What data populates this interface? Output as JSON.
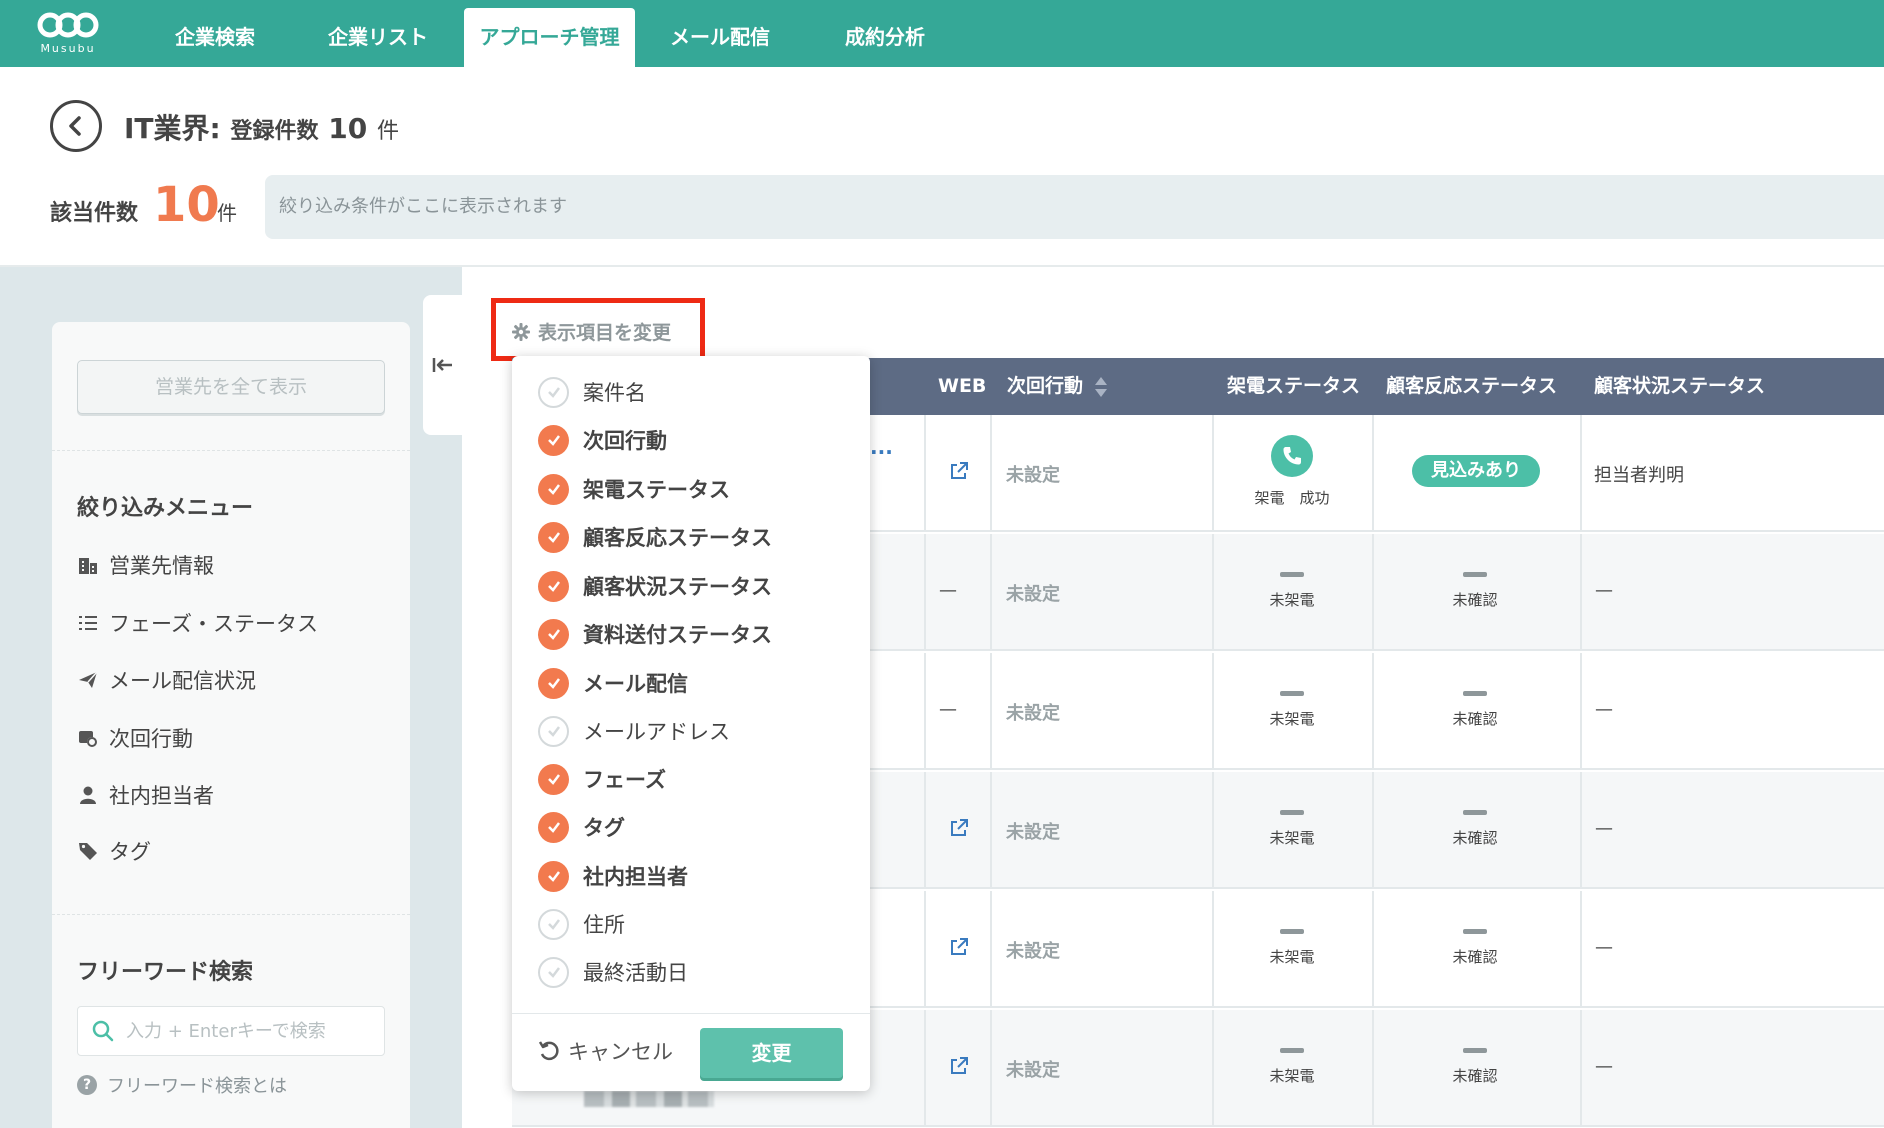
{
  "brand": {
    "logo_text": "Musubu",
    "color": "#35a897"
  },
  "nav": {
    "tabs": [
      {
        "label": "企業検索"
      },
      {
        "label": "企業リスト"
      },
      {
        "label": "アプローチ管理",
        "active": true
      },
      {
        "label": "メール配信"
      },
      {
        "label": "成約分析"
      }
    ]
  },
  "header": {
    "list_name": "IT業界:",
    "registered_label": "登録件数",
    "registered_count": "10",
    "registered_unit": "件",
    "matched_label": "該当件数",
    "matched_count": "10",
    "matched_unit": "件",
    "filter_placeholder": "絞り込み条件がここに表示されます"
  },
  "sidebar": {
    "show_all_label": "営業先を全て表示",
    "filter_menu_heading": "絞り込みメニュー",
    "menu_items": [
      {
        "label": "営業先情報",
        "icon": "building-icon"
      },
      {
        "label": "フェーズ・ステータス",
        "icon": "list-icon"
      },
      {
        "label": "メール配信状況",
        "icon": "paper-plane-icon"
      },
      {
        "label": "次回行動",
        "icon": "calendar-icon"
      },
      {
        "label": "社内担当者",
        "icon": "user-icon"
      },
      {
        "label": "タグ",
        "icon": "tag-icon"
      }
    ],
    "freeword_heading": "フリーワード検索",
    "search_placeholder": "入力 + Enterキーで検索",
    "help_label": "フリーワード検索とは"
  },
  "settings_button_label": "表示項目を変更",
  "table": {
    "headers": {
      "web": "WEB",
      "next_action": "次回行動",
      "call_status": "架電ステータス",
      "reaction_status": "顧客反応ステータス",
      "situation_status": "顧客状況ステータス"
    },
    "row1_truncated": "...",
    "rows": [
      {
        "web": "link",
        "next_action": "未設定",
        "call_status": "架電　成功",
        "reaction_status": "見込みあり",
        "situation_status": "担当者判明"
      },
      {
        "web": "—",
        "next_action": "未設定",
        "call_status": "未架電",
        "reaction_status": "未確認",
        "situation_status": "—"
      },
      {
        "web": "—",
        "next_action": "未設定",
        "call_status": "未架電",
        "reaction_status": "未確認",
        "situation_status": "—"
      },
      {
        "web": "link",
        "next_action": "未設定",
        "call_status": "未架電",
        "reaction_status": "未確認",
        "situation_status": "—"
      },
      {
        "web": "link",
        "next_action": "未設定",
        "call_status": "未架電",
        "reaction_status": "未確認",
        "situation_status": "—"
      },
      {
        "web": "link",
        "next_action": "未設定",
        "call_status": "未架電",
        "reaction_status": "未確認",
        "situation_status": "—"
      }
    ]
  },
  "dropdown": {
    "items": [
      {
        "label": "案件名",
        "checked": false
      },
      {
        "label": "次回行動",
        "checked": true
      },
      {
        "label": "架電ステータス",
        "checked": true
      },
      {
        "label": "顧客反応ステータス",
        "checked": true
      },
      {
        "label": "顧客状況ステータス",
        "checked": true
      },
      {
        "label": "資料送付ステータス",
        "checked": true
      },
      {
        "label": "メール配信",
        "checked": true
      },
      {
        "label": "メールアドレス",
        "checked": false
      },
      {
        "label": "フェーズ",
        "checked": true
      },
      {
        "label": "タグ",
        "checked": true
      },
      {
        "label": "社内担当者",
        "checked": true
      },
      {
        "label": "住所",
        "checked": false
      },
      {
        "label": "最終活動日",
        "checked": false
      }
    ],
    "cancel_label": "キャンセル",
    "submit_label": "変更"
  },
  "colors": {
    "accent_orange": "#f27a4e",
    "highlight_red": "#ee2a14",
    "table_header": "#5d6b84",
    "success_green": "#4cbfa7"
  }
}
